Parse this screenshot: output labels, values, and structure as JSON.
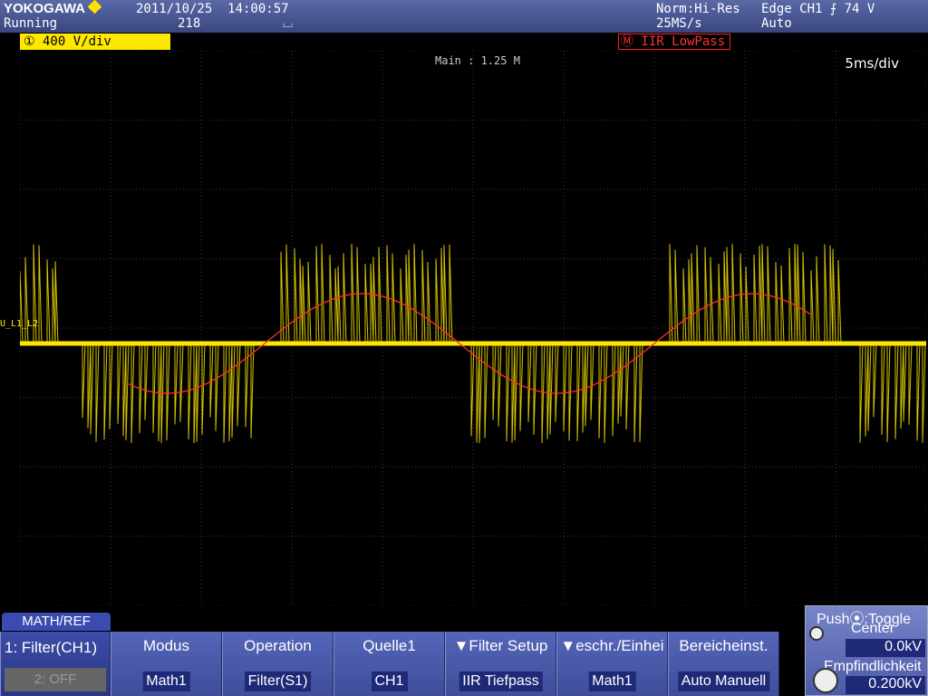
{
  "status": {
    "brand": "YOKOGAWA",
    "datetime": "2011/10/25  14:00:57",
    "state": "Running",
    "count": "218",
    "trigger_mode_icon": "⌴",
    "acq_mode": "Norm:Hi-Res",
    "sample_rate": "25MS/s",
    "trigger": "Edge CH1 ⨍ 74 V",
    "trigger_mode": "Auto"
  },
  "channel": {
    "number": "①",
    "scale": " 400 V/div",
    "bw_icon": "₿W",
    "marker": "U_L1_L2"
  },
  "math_badge": "Ⓜ IIR LowPass",
  "display": {
    "main_length": "Main : 1.25 M",
    "timebase": "5ms/div"
  },
  "colors": {
    "ch1": "#ffe800",
    "math": "#ff3030",
    "grid": "#3a3a3a",
    "menu": "#4a58a8"
  },
  "menu": {
    "title": "MATH/REF",
    "filter_key": {
      "label": "1: Filter(CH1)",
      "sub": "2: OFF"
    },
    "keys": [
      {
        "label": "Modus",
        "value": "Math1"
      },
      {
        "label": "Operation",
        "value": "Filter(S1)"
      },
      {
        "label": "Quelle1",
        "value": "CH1"
      },
      {
        "label": "▼Filter Setup",
        "value": "IIR Tiefpass"
      },
      {
        "label": "▼eschr./Einhei",
        "value": "Math1"
      },
      {
        "label": "Bereicheinst.",
        "value": "Auto Manuell"
      }
    ]
  },
  "knob": {
    "push_label": "Push⦿:Toggle",
    "center_label": "Center",
    "center_value": "0.0kV",
    "sens_label": "Empfindlichkeit",
    "sens_value": "0.200kV"
  },
  "chart_data": {
    "type": "line",
    "xlabel": "",
    "ylabel": "",
    "x_divisions": 10,
    "y_divisions": 8,
    "series": [
      {
        "name": "CH1",
        "description_values": "PWM chopped square, ±1 div envelope peaks"
      },
      {
        "name": "Math1",
        "values_volts_per_div": [
          0,
          -0.6,
          -0.9,
          -0.6,
          0,
          0.6,
          0.9,
          0.6,
          0,
          -0.6,
          -0.9,
          -0.6,
          0,
          0.6,
          0.9,
          0.6,
          0
        ]
      }
    ]
  }
}
